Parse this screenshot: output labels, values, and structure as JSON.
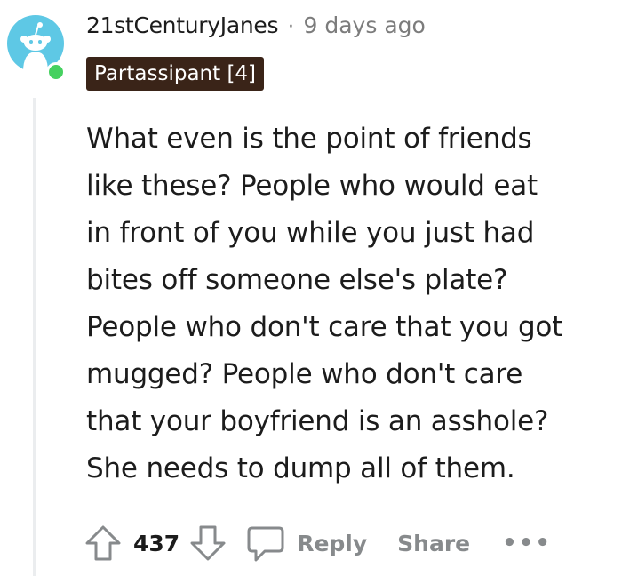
{
  "comment": {
    "username": "21stCenturyJanes",
    "separator": "·",
    "timestamp": "9 days ago",
    "flair": "Partassipant [4]",
    "body_lines": [
      "What even is the point of friends",
      "like these? People who would eat",
      "in front of you while you just had",
      "bites off someone else's plate?",
      "People who don't care that you got",
      "mugged? People who don't care",
      "that your boyfriend is an asshole?",
      "She needs to dump all of them."
    ],
    "votes": "437",
    "reply_label": "Reply",
    "share_label": "Share",
    "more_label": "•••"
  },
  "colors": {
    "avatar_bg": "#5ec8e5",
    "online": "#46d160",
    "flair_bg": "#3a2418",
    "meta": "#7c7c7c",
    "action": "#878a8c"
  },
  "icons": {
    "avatar": "reddit-snoo-avatar",
    "upvote": "arrow-up-icon",
    "downvote": "arrow-down-icon",
    "reply": "speech-bubble-icon",
    "more": "ellipsis-icon"
  }
}
